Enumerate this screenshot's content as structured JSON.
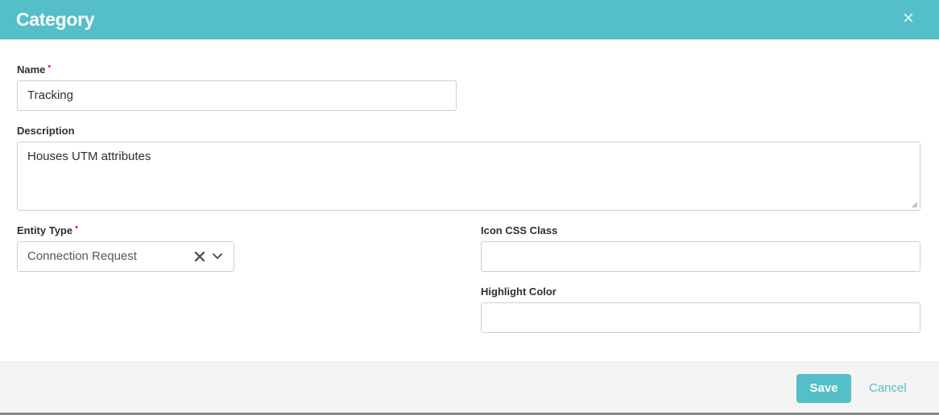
{
  "dialog": {
    "title": "Category",
    "close_icon": "close-icon"
  },
  "form": {
    "name": {
      "label": "Name",
      "required": "•",
      "value": "Tracking"
    },
    "description": {
      "label": "Description",
      "value": "Houses UTM attributes"
    },
    "entity_type": {
      "label": "Entity Type",
      "required": "•",
      "value": "Connection Request",
      "clear_icon": "x-icon",
      "dropdown_icon": "chevron-down-icon"
    },
    "icon_css_class": {
      "label": "Icon CSS Class",
      "value": ""
    },
    "highlight_color": {
      "label": "Highlight Color",
      "value": ""
    }
  },
  "footer": {
    "save_label": "Save",
    "cancel_label": "Cancel"
  },
  "colors": {
    "accent": "#54bfc9",
    "required": "#d4361f"
  }
}
